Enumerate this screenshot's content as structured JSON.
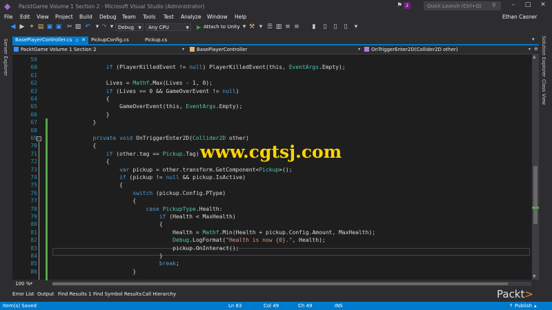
{
  "window": {
    "title": "PacktGame Volume 1 Section 2 - Microsoft Visual Studio (Administrator)",
    "notification_count": "2",
    "quick_launch_placeholder": "Quick Launch (Ctrl+Q)",
    "user": "Ethan Casner"
  },
  "menu": [
    "File",
    "Edit",
    "View",
    "Project",
    "Build",
    "Debug",
    "Team",
    "Tools",
    "Test",
    "Analyze",
    "Window",
    "Help"
  ],
  "toolbar": {
    "configuration": "Debug",
    "platform": "Any CPU",
    "attach_label": "Attach to Unity"
  },
  "side_panels": {
    "left": "Server Explorer",
    "right_top": "Solution Explorer",
    "right_bottom": "Class View"
  },
  "tabs": [
    {
      "label": "BasePlayerController.cs",
      "active": true
    },
    {
      "label": "PickupConfig.cs",
      "active": false
    },
    {
      "label": "Pickup.cs",
      "active": false
    }
  ],
  "navbar": {
    "project": "PacktGame Volume 1 Section 2",
    "class": "BasePlayerController",
    "member": "OnTriggerEnter2D(Collider2D other)"
  },
  "code_lines": [
    {
      "n": "59",
      "text": ""
    },
    {
      "n": "60",
      "text": "            if (PlayerKilledEvent != null) PlayerKilledEvent(this, EventArgs.Empty);"
    },
    {
      "n": "61",
      "text": ""
    },
    {
      "n": "62",
      "text": "            Lives = Mathf.Max(Lives - 1, 0);"
    },
    {
      "n": "63",
      "text": "            if (Lives == 0 && GameOverEvent != null)"
    },
    {
      "n": "64",
      "text": "            {"
    },
    {
      "n": "65",
      "text": "                GameOverEvent(this, EventArgs.Empty);"
    },
    {
      "n": "66",
      "text": "            }"
    },
    {
      "n": "67",
      "text": "        }"
    },
    {
      "n": "68",
      "text": ""
    },
    {
      "n": "69",
      "text": "        private void OnTriggerEnter2D(Collider2D other)"
    },
    {
      "n": "70",
      "text": "        {"
    },
    {
      "n": "71",
      "text": "            if (other.tag == Pickup.Tag)"
    },
    {
      "n": "72",
      "text": "            {"
    },
    {
      "n": "73",
      "text": "                var pickup = other.transform.GetComponent<Pickup>();"
    },
    {
      "n": "74",
      "text": "                if (pickup != null && pickup.IsActive)"
    },
    {
      "n": "75",
      "text": "                {"
    },
    {
      "n": "76",
      "text": "                    switch (pickup.Config.PType)"
    },
    {
      "n": "77",
      "text": "                    {"
    },
    {
      "n": "78",
      "text": "                        case PickupType.Health:"
    },
    {
      "n": "79",
      "text": "                            if (Health < MaxHealth)"
    },
    {
      "n": "80",
      "text": "                            {"
    },
    {
      "n": "81",
      "text": "                                Health = Mathf.Min(Health + pickup.Config.Amount, MaxHealth);"
    },
    {
      "n": "82",
      "text": "                                Debug.LogFormat(\"Health is now {0}.\", Health);"
    },
    {
      "n": "83",
      "text": "                                pickup.OnInteract();"
    },
    {
      "n": "84",
      "text": "                            }"
    },
    {
      "n": "85",
      "text": "                            break;"
    },
    {
      "n": "86",
      "text": "                    }"
    }
  ],
  "watermark": "www.cgtsj.com",
  "zoom": "100 %",
  "tool_windows": [
    "Error List",
    "Output",
    "Find Results 1",
    "Find Symbol Results",
    "Call Hierarchy"
  ],
  "brand": "Packt",
  "status": {
    "message": "Item(s) Saved",
    "line": "Ln 83",
    "col": "Col 49",
    "ch": "Ch 49",
    "mode": "INS",
    "publish": "Publish"
  },
  "colors": {
    "accent": "#007acc",
    "keyword": "#569cd6",
    "type": "#4ec9b0",
    "string": "#d69d85",
    "line_number": "#2b91af",
    "editor_bg": "#1e1e1e",
    "watermark": "#ffd400"
  }
}
